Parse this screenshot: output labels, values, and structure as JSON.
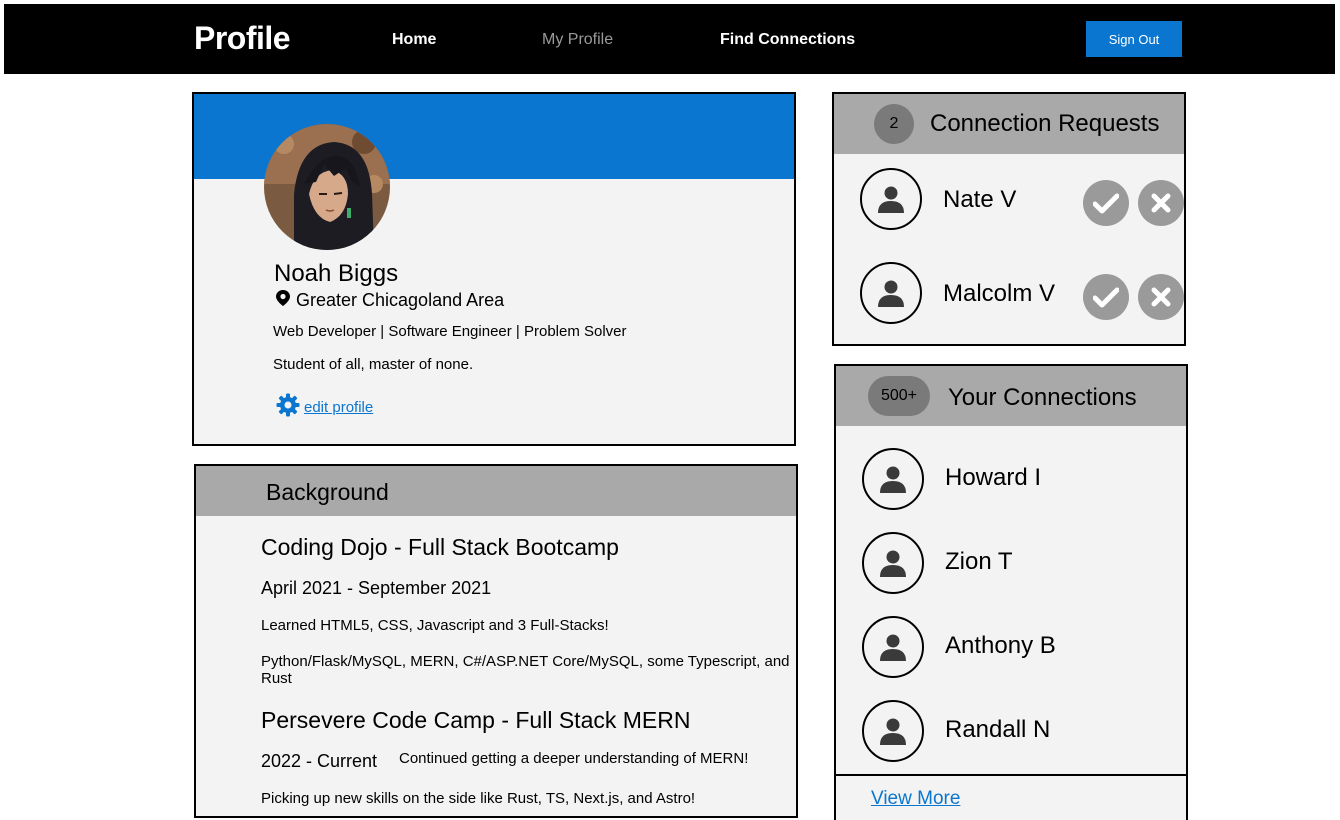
{
  "nav": {
    "brand": "Profile",
    "links": [
      {
        "label": "Home",
        "active": false
      },
      {
        "label": "My Profile",
        "active": true
      },
      {
        "label": "Find Connections",
        "active": false
      }
    ],
    "sign_out": "Sign Out"
  },
  "profile": {
    "name": "Noah Biggs",
    "location": "Greater Chicagoland Area",
    "headline": "Web Developer | Software Engineer | Problem Solver",
    "bio": "Student of all, master of none.",
    "edit_label": "edit profile",
    "banner_color": "#0b76cf"
  },
  "background": {
    "title": "Background",
    "entries": [
      {
        "school": "Coding Dojo - Full Stack Bootcamp",
        "dates": "April 2021 - September 2021",
        "text1": "Learned HTML5, CSS, Javascript and 3 Full-Stacks!",
        "text2": "Python/Flask/MySQL, MERN, C#/ASP.NET Core/MySQL, some Typescript, and Rust"
      },
      {
        "school": "Persevere Code Camp - Full Stack MERN",
        "dates": "2022 - Current",
        "text1": "Continued getting a deeper understanding of MERN!",
        "text2": "Picking up new skills on the side like Rust, TS, Next.js, and Astro!"
      }
    ]
  },
  "requests": {
    "count": "2",
    "title": "Connection Requests",
    "people": [
      {
        "name": "Nate V"
      },
      {
        "name": "Malcolm V"
      }
    ]
  },
  "connections": {
    "count": "500+",
    "title": "Your Connections",
    "people": [
      {
        "name": "Howard I"
      },
      {
        "name": "Zion T"
      },
      {
        "name": "Anthony B"
      },
      {
        "name": "Randall N"
      }
    ],
    "view_more": "View More"
  },
  "colors": {
    "accent": "#0b76cf",
    "header_gray": "#a9a9a9",
    "card_bg": "#f3f3f3",
    "icon_gray": "#9a9a9a"
  }
}
